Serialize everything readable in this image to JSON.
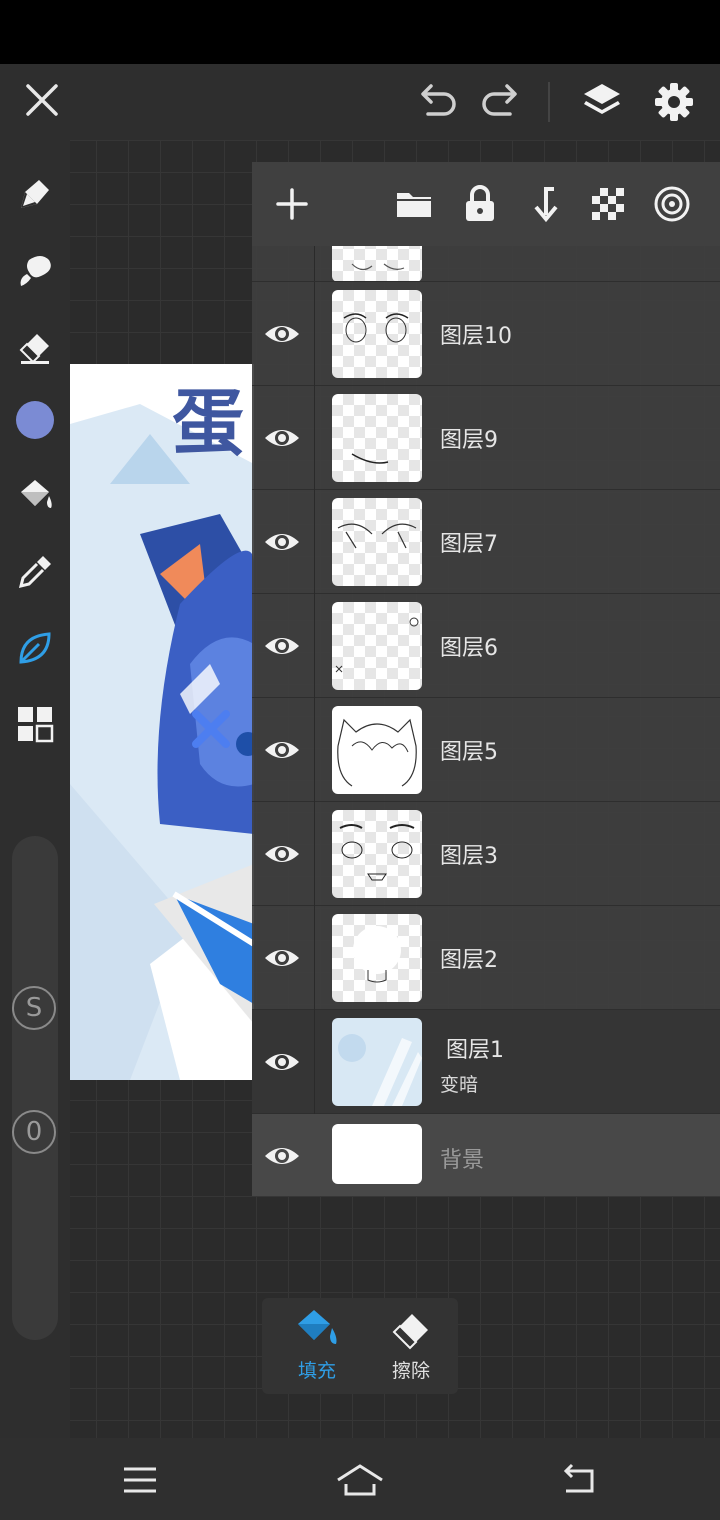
{
  "colors": {
    "accent": "#2f9ee6",
    "current_color": "#7b8bd4",
    "panel_bg": "#3e3e3e",
    "toolbar_bg": "#2e2e2e"
  },
  "topbar": {
    "icons": [
      "close-icon",
      "undo-icon",
      "redo-icon",
      "layers-icon",
      "settings-icon"
    ]
  },
  "left_tools": [
    "pen-icon",
    "brush-icon",
    "eraser-icon",
    "color-swatch",
    "fill-bucket-icon",
    "eyedropper-icon",
    "leaf-tool-icon",
    "grid-tool-icon"
  ],
  "left_sliders": {
    "size_label": "S",
    "opacity_label": "0"
  },
  "layer_toolbar": {
    "icons": [
      "add-layer-icon",
      "folder-icon",
      "lock-icon",
      "merge-down-icon",
      "checkerboard-icon",
      "clipping-icon"
    ]
  },
  "layers": [
    {
      "name": "图层10",
      "visible": true
    },
    {
      "name": "图层9",
      "visible": true
    },
    {
      "name": "图层7",
      "visible": true
    },
    {
      "name": "图层6",
      "visible": true
    },
    {
      "name": "图层5",
      "visible": true
    },
    {
      "name": "图层3",
      "visible": true
    },
    {
      "name": "图层2",
      "visible": true
    },
    {
      "name": "图层1",
      "blend_mode": "变暗",
      "visible": true
    },
    {
      "name": "背景",
      "visible": true
    }
  ],
  "canvas_art": {
    "title_char": "蛋"
  },
  "fill_erase": {
    "fill_label": "填充",
    "erase_label": "擦除"
  },
  "navbar": {
    "icons": [
      "menu-icon",
      "home-icon",
      "back-icon"
    ]
  }
}
